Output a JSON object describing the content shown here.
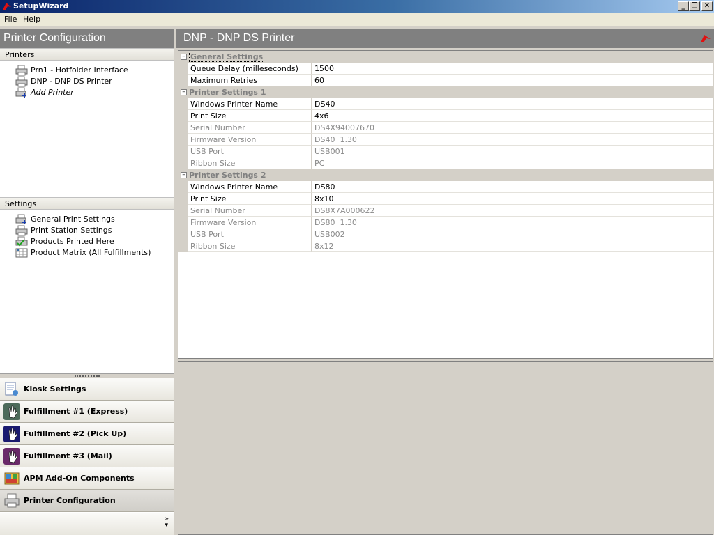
{
  "window": {
    "title": "SetupWizard"
  },
  "menubar": {
    "items": [
      "File",
      "Help"
    ]
  },
  "left": {
    "header": "Printer Configuration",
    "printers_section": "Printers",
    "printers": [
      {
        "label": "Prn1 - Hotfolder Interface",
        "icon": "printer-icon"
      },
      {
        "label": "DNP - DNP DS Printer",
        "icon": "printer-icon"
      },
      {
        "label": "Add Printer",
        "icon": "add-printer-icon"
      }
    ],
    "settings_section": "Settings",
    "settings": [
      {
        "label": "General Print Settings",
        "icon": "settings-printer-icon"
      },
      {
        "label": "Print Station Settings",
        "icon": "printer-icon"
      },
      {
        "label": "Products Printed Here",
        "icon": "check-printer-icon"
      },
      {
        "label": "Product Matrix (All Fulfillments)",
        "icon": "matrix-icon"
      }
    ],
    "nav": [
      {
        "label": "Kiosk Settings",
        "icon": "kiosk-icon"
      },
      {
        "label": "Fulfillment #1 (Express)",
        "icon": "hand-icon"
      },
      {
        "label": "Fulfillment #2 (Pick Up)",
        "icon": "hand-icon"
      },
      {
        "label": "Fulfillment #3 (Mail)",
        "icon": "hand-icon"
      },
      {
        "label": "APM Add-On Components",
        "icon": "addon-icon"
      },
      {
        "label": "Printer Configuration",
        "icon": "printer-icon",
        "selected": true
      }
    ]
  },
  "right": {
    "header": "DNP - DNP DS Printer",
    "categories": [
      {
        "title": "General Settings",
        "rows": [
          {
            "name": "Queue Delay (milleseconds)",
            "value": "1500",
            "readonly": false
          },
          {
            "name": "Maximum Retries",
            "value": "60",
            "readonly": false
          }
        ]
      },
      {
        "title": "Printer Settings 1",
        "rows": [
          {
            "name": "Windows Printer Name",
            "value": "DS40",
            "readonly": false
          },
          {
            "name": "Print Size",
            "value": "4x6",
            "readonly": false
          },
          {
            "name": "Serial Number",
            "value": "DS4X94007670",
            "readonly": true
          },
          {
            "name": "Firmware Version",
            "value": "DS40  1.30",
            "readonly": true
          },
          {
            "name": "USB Port",
            "value": "USB001",
            "readonly": true
          },
          {
            "name": "Ribbon Size",
            "value": "PC",
            "readonly": true
          }
        ]
      },
      {
        "title": "Printer Settings 2",
        "rows": [
          {
            "name": "Windows Printer Name",
            "value": "DS80",
            "readonly": false
          },
          {
            "name": "Print Size",
            "value": "8x10",
            "readonly": false
          },
          {
            "name": "Serial Number",
            "value": "DS8X7A000622",
            "readonly": true
          },
          {
            "name": "Firmware Version",
            "value": "DS80  1.30",
            "readonly": true
          },
          {
            "name": "USB Port",
            "value": "USB002",
            "readonly": true
          },
          {
            "name": "Ribbon Size",
            "value": "8x12",
            "readonly": true
          }
        ]
      }
    ]
  },
  "colors": {
    "header_gray": "#808080",
    "title_start": "#0a246a",
    "title_end": "#a6caf0",
    "readonly_text": "#8a8a8a"
  }
}
